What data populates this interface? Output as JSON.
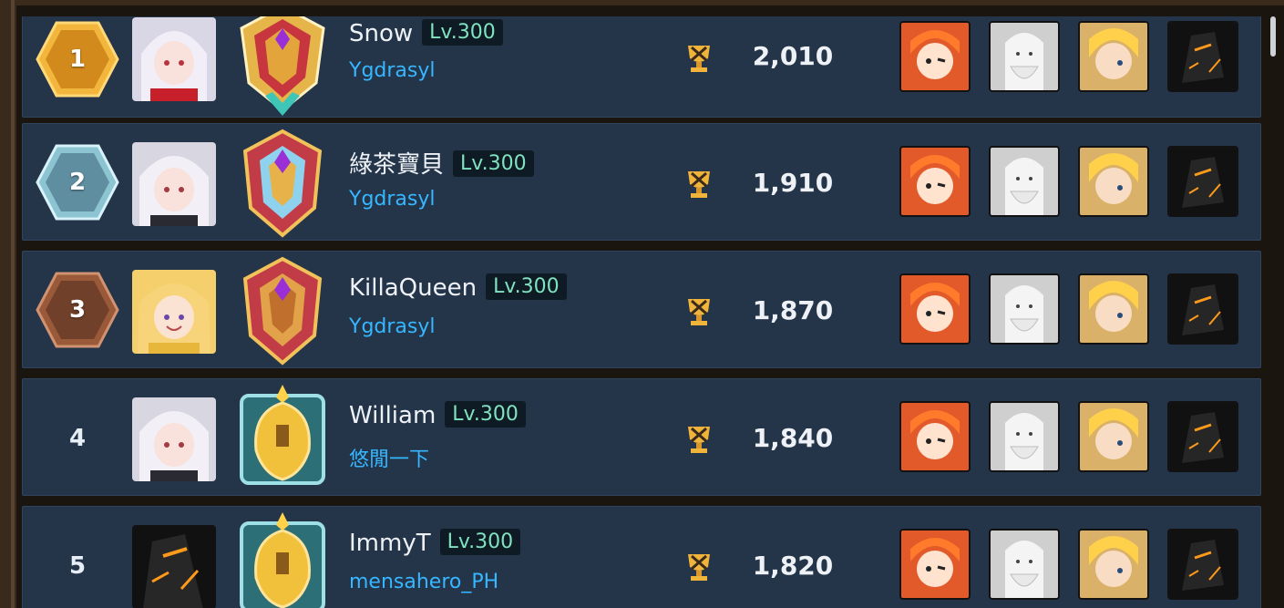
{
  "colors": {
    "row_bg": "#243449",
    "name_text": "#eef2f7",
    "level_text": "#7fe3c0",
    "guild_text": "#36b7ff",
    "gold": "#e8a33a",
    "silver": "#9fd0dd",
    "bronze": "#9a5a3a"
  },
  "rows": [
    {
      "rank": "1",
      "name": "Snow",
      "level": "Lv.300",
      "guild": "Ygdrasyl",
      "score": "2,010",
      "avatar": "silver-hair-girl-red-avatar",
      "emblem": "gold-crest-emblem-purple-gem",
      "trophy_icon": "crossed-trophy-icon"
    },
    {
      "rank": "2",
      "name": "綠茶寶貝",
      "level": "Lv.300",
      "guild": "Ygdrasyl",
      "score": "1,910",
      "avatar": "silver-hair-girl-avatar",
      "emblem": "gold-shield-emblem-purple-gem",
      "trophy_icon": "crossed-trophy-icon"
    },
    {
      "rank": "3",
      "name": "KillaQueen",
      "level": "Lv.300",
      "guild": "Ygdrasyl",
      "score": "1,870",
      "avatar": "blonde-girl-avatar",
      "emblem": "gold-shield-emblem-purple-gem",
      "trophy_icon": "crossed-trophy-icon"
    },
    {
      "rank": "4",
      "name": "William",
      "level": "Lv.300",
      "guild": "悠閒一下",
      "score": "1,840",
      "avatar": "silver-hair-girl-avatar",
      "emblem": "spartan-helmet-emblem",
      "trophy_icon": "crossed-trophy-icon"
    },
    {
      "rank": "5",
      "name": "ImmyT",
      "level": "Lv.300",
      "guild": "mensahero_PH",
      "score": "1,820",
      "avatar": "dark-armor-knight-avatar",
      "emblem": "spartan-helmet-emblem",
      "trophy_icon": "crossed-trophy-icon"
    }
  ],
  "team_heroes": [
    "orange-hair-winking-girl-icon",
    "white-beard-old-man-icon",
    "blonde-boy-icon",
    "dark-armor-knight-icon"
  ]
}
